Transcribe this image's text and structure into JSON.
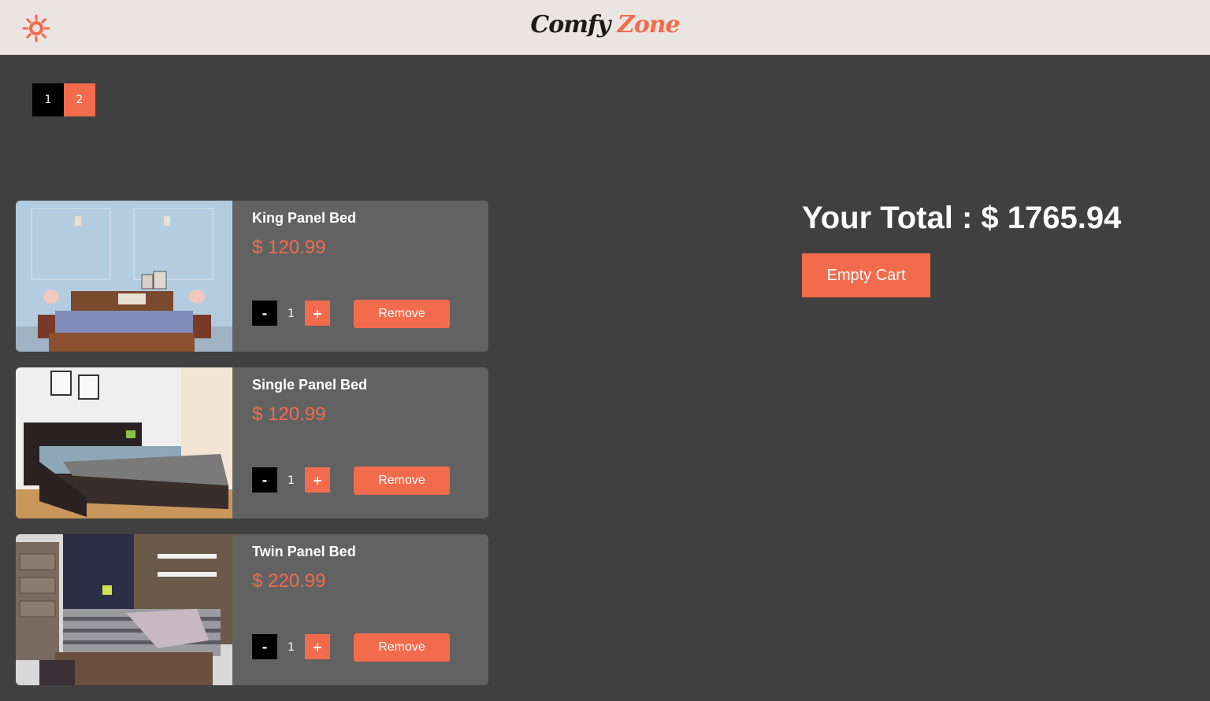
{
  "brand": {
    "part1": "Comfy",
    "part2": "Zone"
  },
  "header": {
    "theme_icon": "sun-icon"
  },
  "pagination": {
    "pages": [
      "1",
      "2"
    ],
    "active_index": 0
  },
  "cart": {
    "items": [
      {
        "name": "King Panel Bed",
        "price": "$ 120.99",
        "quantity": "1",
        "minus": "-",
        "plus": "+",
        "remove_label": "Remove",
        "image": "king-panel-bed-photo"
      },
      {
        "name": "Single Panel Bed",
        "price": "$ 120.99",
        "quantity": "1",
        "minus": "-",
        "plus": "+",
        "remove_label": "Remove",
        "image": "single-panel-bed-photo"
      },
      {
        "name": "Twin Panel Bed",
        "price": "$ 220.99",
        "quantity": "1",
        "minus": "-",
        "plus": "+",
        "remove_label": "Remove",
        "image": "twin-panel-bed-photo"
      }
    ]
  },
  "summary": {
    "total_text": "Your Total : $ 1765.94",
    "empty_label": "Empty Cart"
  },
  "colors": {
    "accent": "#f26b4d",
    "background": "#404040",
    "card": "#626262",
    "header": "#ebe5e1"
  }
}
